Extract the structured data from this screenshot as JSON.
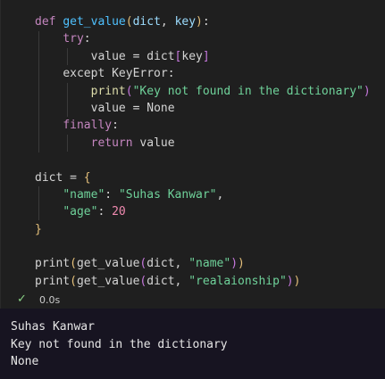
{
  "cell": {
    "status_icon": "check-icon",
    "exec_time": "0.0s",
    "lines": [
      [
        {
          "t": "def ",
          "c": "def"
        },
        {
          "t": "get_value",
          "c": "fn"
        },
        {
          "t": "(",
          "c": "brk"
        },
        {
          "t": "dict",
          "c": "var"
        },
        {
          "t": ", ",
          "c": "plain"
        },
        {
          "t": "key",
          "c": "var"
        },
        {
          "t": ")",
          "c": "brk"
        },
        {
          "t": ":",
          "c": "plain"
        }
      ],
      [
        {
          "t": "    ",
          "c": "plain"
        },
        {
          "t": "try",
          "c": "kw"
        },
        {
          "t": ":",
          "c": "plain"
        }
      ],
      [
        {
          "t": "        ",
          "c": "plain"
        },
        {
          "t": "value = dict",
          "c": "plain"
        },
        {
          "t": "[",
          "c": "brk2"
        },
        {
          "t": "key",
          "c": "plain"
        },
        {
          "t": "]",
          "c": "brk2"
        }
      ],
      [
        {
          "t": "    ",
          "c": "plain"
        },
        {
          "t": "except KeyError:",
          "c": "plain"
        }
      ],
      [
        {
          "t": "        ",
          "c": "plain"
        },
        {
          "t": "print",
          "c": "fn2"
        },
        {
          "t": "(",
          "c": "brk2"
        },
        {
          "t": "\"Key not found in the dictionary\"",
          "c": "str"
        },
        {
          "t": ")",
          "c": "brk2"
        }
      ],
      [
        {
          "t": "        ",
          "c": "plain"
        },
        {
          "t": "value = None",
          "c": "plain"
        }
      ],
      [
        {
          "t": "    ",
          "c": "plain"
        },
        {
          "t": "finally",
          "c": "kw"
        },
        {
          "t": ":",
          "c": "plain"
        }
      ],
      [
        {
          "t": "        ",
          "c": "plain"
        },
        {
          "t": "return",
          "c": "kw"
        },
        {
          "t": " value",
          "c": "plain"
        }
      ],
      [],
      [
        {
          "t": "dict = ",
          "c": "plain"
        },
        {
          "t": "{",
          "c": "brk"
        }
      ],
      [
        {
          "t": "    ",
          "c": "plain"
        },
        {
          "t": "\"name\"",
          "c": "str"
        },
        {
          "t": ": ",
          "c": "plain"
        },
        {
          "t": "\"Suhas Kanwar\"",
          "c": "str"
        },
        {
          "t": ",",
          "c": "plain"
        }
      ],
      [
        {
          "t": "    ",
          "c": "plain"
        },
        {
          "t": "\"age\"",
          "c": "str"
        },
        {
          "t": ": ",
          "c": "plain"
        },
        {
          "t": "20",
          "c": "num"
        }
      ],
      [
        {
          "t": "}",
          "c": "brk"
        }
      ],
      [],
      [
        {
          "t": "print",
          "c": "plain"
        },
        {
          "t": "(",
          "c": "brk"
        },
        {
          "t": "get_value",
          "c": "plain"
        },
        {
          "t": "(",
          "c": "brk2"
        },
        {
          "t": "dict, ",
          "c": "plain"
        },
        {
          "t": "\"name\"",
          "c": "str"
        },
        {
          "t": ")",
          "c": "brk2"
        },
        {
          "t": ")",
          "c": "brk"
        }
      ],
      [
        {
          "t": "print",
          "c": "plain"
        },
        {
          "t": "(",
          "c": "brk"
        },
        {
          "t": "get_value",
          "c": "plain"
        },
        {
          "t": "(",
          "c": "brk2"
        },
        {
          "t": "dict, ",
          "c": "plain"
        },
        {
          "t": "\"realaionship\"",
          "c": "str"
        },
        {
          "t": ")",
          "c": "brk2"
        },
        {
          "t": ")",
          "c": "brk"
        }
      ]
    ]
  },
  "output": {
    "lines": [
      "Suhas Kanwar",
      "Key not found in the dictionary",
      "None"
    ]
  }
}
